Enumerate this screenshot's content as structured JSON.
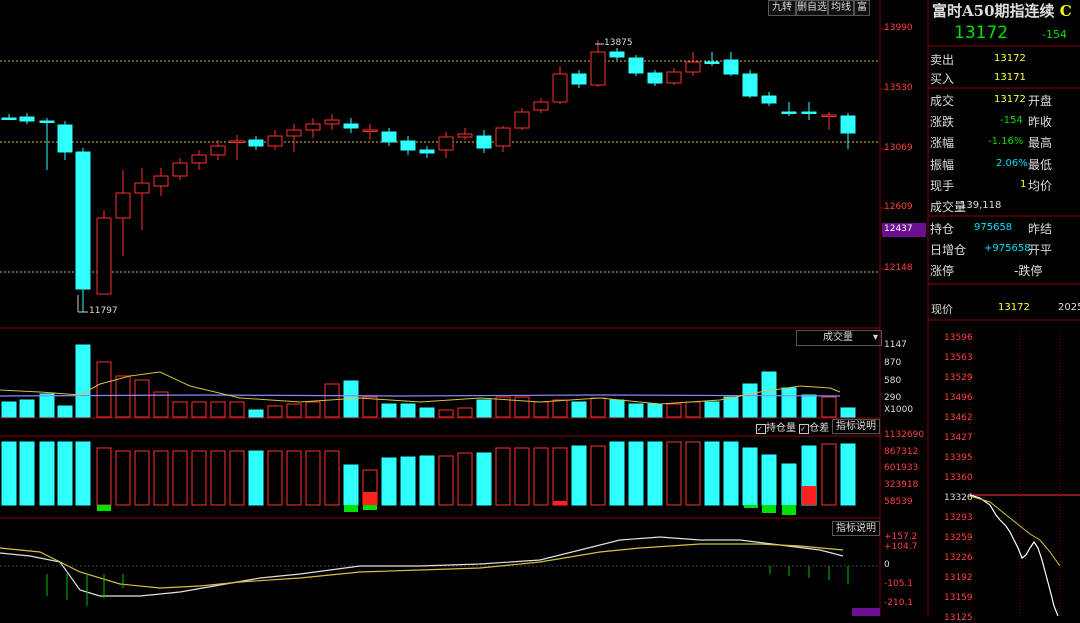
{
  "toolbar": {
    "btn1": "九转",
    "btn2": "删自选",
    "btn3": "均线",
    "btn4": "富"
  },
  "price_axis": {
    "ticks": [
      "13990",
      "13530",
      "13069",
      "12609",
      "12148"
    ],
    "current": "12437"
  },
  "annotations": {
    "high": "13875",
    "low": "11797"
  },
  "volume_panel": {
    "title": "成交量",
    "ticks": [
      "1147",
      "870",
      "580",
      "290"
    ],
    "unit": "X1000"
  },
  "oi_panel": {
    "legend1": "持仓量",
    "legend2": "仓差",
    "explain": "指标说明",
    "ticks": [
      "1132690",
      "867312",
      "601933",
      "323918",
      "58539"
    ]
  },
  "ind_panel": {
    "explain": "指标说明",
    "ticks": [
      "+157.2",
      "+104.7",
      "0",
      "-105.1",
      "-210.1"
    ]
  },
  "quote": {
    "name": "富时A50期指连续",
    "last": "13172",
    "change": "-154",
    "rows": [
      {
        "l": "卖出",
        "v": "13172",
        "v2": "",
        "r": ""
      },
      {
        "l": "买入",
        "v": "13171",
        "v2": "",
        "r": ""
      },
      {
        "l": "成交",
        "v": "13172",
        "v2": "开盘",
        "r": ""
      },
      {
        "l": "涨跌",
        "v": "-154",
        "v2": "昨收",
        "r": ""
      },
      {
        "l": "涨幅",
        "v": "-1.16%",
        "v2": "最高",
        "r": ""
      },
      {
        "l": "振幅",
        "v": "2.06%",
        "v2": "最低",
        "r": ""
      },
      {
        "l": "现手",
        "v": "1",
        "v2": "均价",
        "r": ""
      },
      {
        "l": "成交量",
        "v": "139,118",
        "v2": "",
        "r": ""
      },
      {
        "l": "持仓",
        "v": "975658",
        "v2": "昨结",
        "r": ""
      },
      {
        "l": "日增仓",
        "v": "+975658",
        "v2": "开平",
        "r": ""
      },
      {
        "l": "涨停",
        "v": "",
        "v2": "-跌停",
        "r": ""
      }
    ],
    "now_label": "现价",
    "now_value": "13172",
    "now_extra": "2025"
  },
  "mini_axis": [
    "13596",
    "13563",
    "13529",
    "13496",
    "13462",
    "13427",
    "13395",
    "13360",
    "13326",
    "13293",
    "13259",
    "13226",
    "13192",
    "13159",
    "13125"
  ],
  "colors": {
    "up": "#ff3030",
    "down": "#30ffff",
    "bg": "#000000",
    "grid": "#8a0000"
  }
}
